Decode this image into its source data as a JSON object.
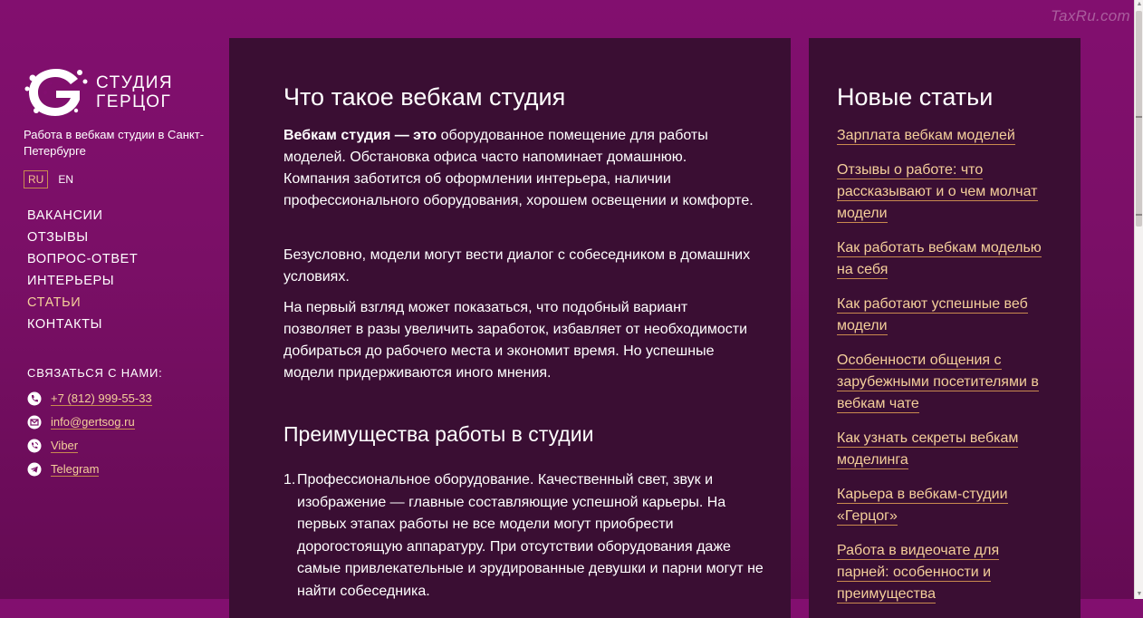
{
  "watermark": "TaxRu.com",
  "logo": {
    "line1": "СТУДИЯ",
    "line2": "ГЕРЦОГ"
  },
  "tagline": "Работа в вебкам студии в Санкт-Петербурге",
  "languages": {
    "ru": "RU",
    "en": "EN"
  },
  "nav": [
    {
      "label": "ВАКАНСИИ"
    },
    {
      "label": "ОТЗЫВЫ"
    },
    {
      "label": "ВОПРОС-ОТВЕТ"
    },
    {
      "label": "ИНТЕРЬЕРЫ"
    },
    {
      "label": "СТАТЬИ",
      "active": true
    },
    {
      "label": "КОНТАКТЫ"
    }
  ],
  "contacts": {
    "title": "СВЯЗАТЬСЯ С НАМИ:",
    "phone": "+7 (812) 999-55-33",
    "email": "info@gertsog.ru",
    "viber": "Viber",
    "telegram": "Telegram"
  },
  "main": {
    "title": "Что такое вебкам студия",
    "p1_bold": "Вебкам студия — это",
    "p1_rest": " оборудованное помещение для работы моделей. Обстановка офиса часто напоминает домашнюю. Компания заботится об оформлении интерьера, наличии профессионального оборудования, хорошем освещении и комфорте.",
    "p2": "Безусловно, модели могут вести диалог с собеседником в домашних условиях.",
    "p3": "На первый взгляд может показаться, что подобный вариант позволяет в разы увеличить заработок, избавляет от необходимости добираться до рабочего места и экономит время. Но успешные модели придерживаются иного мнения.",
    "subtitle": "Преимущества работы в студии",
    "list": [
      {
        "num": "1.",
        "text": "Профессиональное оборудование. Качественный свет, звук и изображение — главные составляющие успешной карьеры. На первых этапах работы не все модели могут приобрести дорогостоящую аппаратуру. При отсутствии оборудования даже самые привлекательные и эрудированные девушки и парни могут не найти собеседника."
      }
    ]
  },
  "sidebar_right": {
    "title": "Новые статьи",
    "articles": [
      {
        "label": "Зарплата вебкам моделей"
      },
      {
        "label": "Отзывы о работе: что рассказывают и о чем молчат модели"
      },
      {
        "label": "Как работать вебкам моделью на себя"
      },
      {
        "label": "Как работают успешные веб модели"
      },
      {
        "label": "Особенности общения с зарубежными посетителями в вебкам чате"
      },
      {
        "label": "Как узнать секреты вебкам моделинга"
      },
      {
        "label": "Карьера в вебкам-студии «Герцог»"
      },
      {
        "label": "Работа в видеочате для парней: особенности и преимущества"
      }
    ]
  },
  "colors": {
    "background": "#7a0f66",
    "panel": "#3a0e33",
    "accent_link": "#f4cf9a",
    "link_underline": "#c98a4f"
  }
}
